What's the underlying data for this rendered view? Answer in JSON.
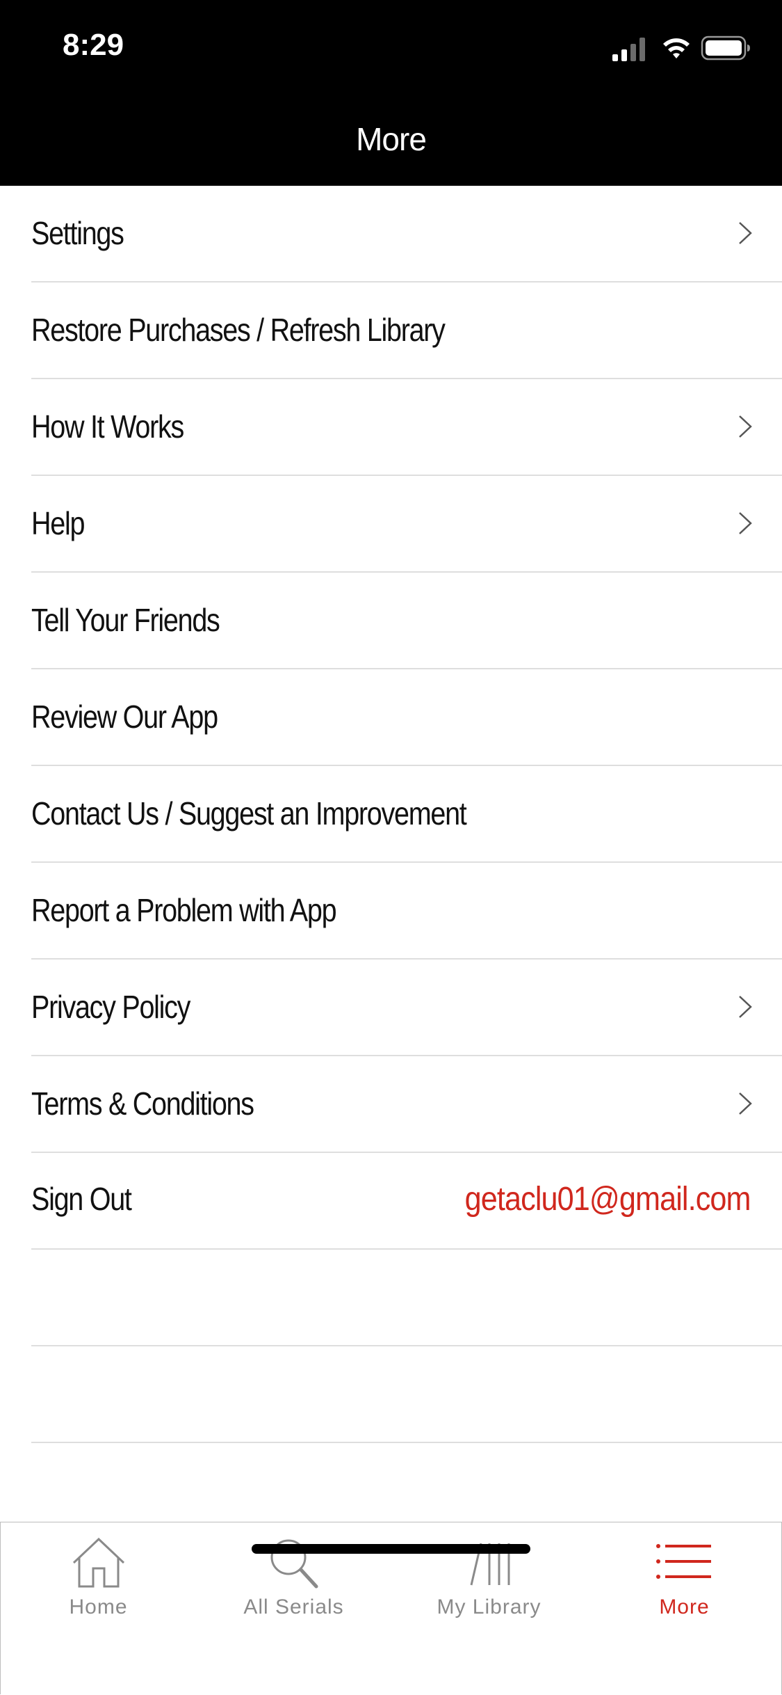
{
  "status_bar": {
    "time": "8:29"
  },
  "nav": {
    "title": "More"
  },
  "menu": {
    "items": [
      {
        "label": "Settings",
        "chevron": true
      },
      {
        "label": "Restore Purchases / Refresh Library",
        "chevron": false
      },
      {
        "label": "How It Works",
        "chevron": true
      },
      {
        "label": "Help",
        "chevron": true
      },
      {
        "label": "Tell Your Friends",
        "chevron": false
      },
      {
        "label": "Review Our App",
        "chevron": false
      },
      {
        "label": "Contact Us / Suggest an Improvement",
        "chevron": false
      },
      {
        "label": "Report a Problem with App",
        "chevron": false
      },
      {
        "label": "Privacy Policy",
        "chevron": true
      },
      {
        "label": "Terms & Conditions",
        "chevron": true
      }
    ],
    "sign_out": {
      "label": "Sign Out",
      "email": "getaclu01@gmail.com"
    }
  },
  "tab_bar": {
    "tabs": [
      {
        "label": "Home",
        "icon": "home-icon",
        "active": false
      },
      {
        "label": "All Serials",
        "icon": "search-icon",
        "active": false
      },
      {
        "label": "My Library",
        "icon": "library-icon",
        "active": false
      },
      {
        "label": "More",
        "icon": "menu-icon",
        "active": true
      }
    ]
  },
  "colors": {
    "accent": "#d0271d",
    "header_bg": "#000000",
    "inactive": "#8a8a8a"
  }
}
